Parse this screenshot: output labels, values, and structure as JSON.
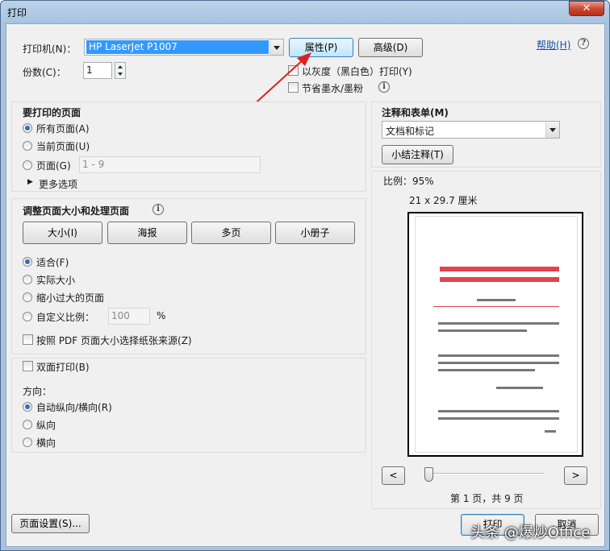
{
  "window": {
    "title": "打印",
    "close": "✕"
  },
  "printer": {
    "label": "打印机(N)：",
    "name": "HP LaserJet P1007",
    "properties_btn": "属性(P)",
    "advanced_btn": "高级(D)",
    "help_link": "帮助(H)",
    "copies_label": "份数(C)：",
    "copies_value": "1",
    "grayscale_label": "以灰度（黑白色）打印(Y)",
    "save_ink_label": "节省墨水/墨粉"
  },
  "pages_section": {
    "title": "要打印的页面",
    "all": "所有页面(A)",
    "current": "当前页面(U)",
    "pages": "页面(G)",
    "pages_placeholder": "1 - 9",
    "more": "更多选项"
  },
  "sizing_section": {
    "title": "调整页面大小和处理页面",
    "tabs": [
      "大小(I)",
      "海报",
      "多页",
      "小册子"
    ],
    "fit": "适合(F)",
    "actual": "实际大小",
    "shrink": "缩小过大的页面",
    "custom": "自定义比例：",
    "custom_value": "100",
    "percent": "%",
    "paper_source": "按照 PDF 页面大小选择纸张来源(Z)"
  },
  "duplex_section": {
    "duplex": "双面打印(B)",
    "orientation": "方向：",
    "auto": "自动纵向/横向(R)",
    "portrait": "纵向",
    "landscape": "横向"
  },
  "comments_section": {
    "title": "注释和表单(M)",
    "selected": "文档和标记",
    "summarize_btn": "小结注释(T)"
  },
  "preview": {
    "scale_label": "比例：95%",
    "dimensions": "21 x 29.7 厘米",
    "prev": "<",
    "next": ">",
    "page_info": "第 1 页，共 9 页"
  },
  "footer": {
    "page_setup": "页面设置(S)...",
    "print": "打印",
    "cancel": "取消",
    "watermark": "头条 @爆炒Office"
  },
  "colors": {
    "accent": "#2f6fb6",
    "arrow": "#e02020",
    "title_red": "#e0454d"
  }
}
